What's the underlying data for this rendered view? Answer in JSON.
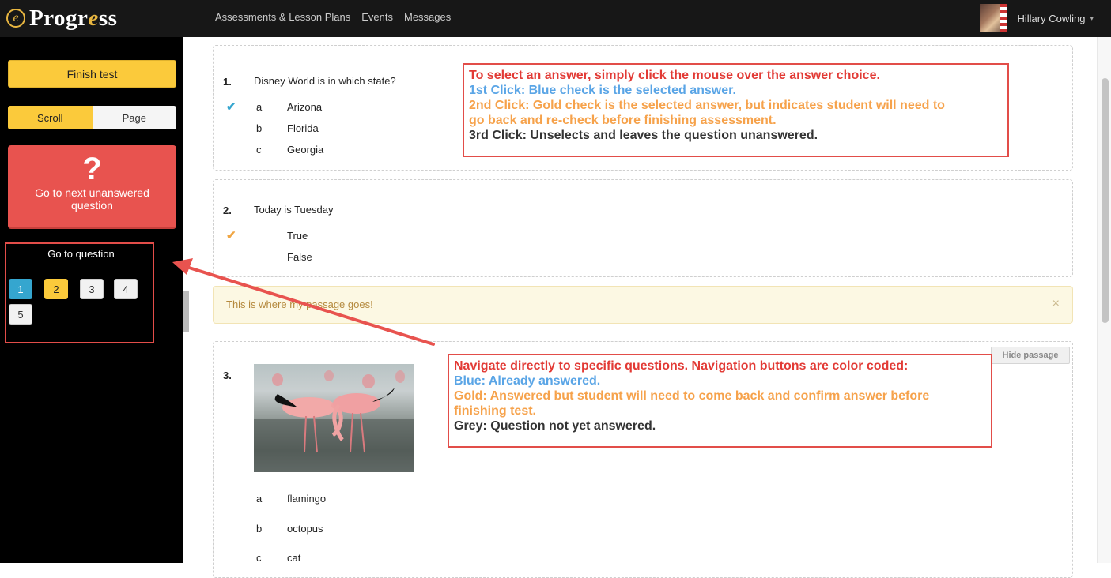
{
  "brand": {
    "logo_icon": "e",
    "name_pre": "Progr",
    "name_hl": "e",
    "name_post": "ss"
  },
  "nav": {
    "items": [
      "Assessments & Lesson Plans",
      "Events",
      "Messages"
    ]
  },
  "user": {
    "name": "Hillary Cowling"
  },
  "sidebar": {
    "finish_label": "Finish test",
    "mode_scroll": "Scroll",
    "mode_page": "Page",
    "next_symbol": "?",
    "next_label": "Go to next unanswered question",
    "goto_title": "Go to question",
    "question_buttons": [
      {
        "label": "1",
        "status": "answered",
        "color": "#35a6cf"
      },
      {
        "label": "2",
        "status": "recheck",
        "color": "#fbca3b"
      },
      {
        "label": "3",
        "status": "unanswered",
        "color": "#f2f2f2"
      },
      {
        "label": "4",
        "status": "unanswered",
        "color": "#f2f2f2"
      },
      {
        "label": "5",
        "status": "unanswered",
        "color": "#f2f2f2"
      }
    ]
  },
  "questions": [
    {
      "number": "1.",
      "text": "Disney World is in which state?",
      "options": [
        {
          "letter": "a",
          "text": "Arizona",
          "check": "blue"
        },
        {
          "letter": "b",
          "text": "Florida"
        },
        {
          "letter": "c",
          "text": "Georgia"
        }
      ]
    },
    {
      "number": "2.",
      "text": "Today is Tuesday",
      "options": [
        {
          "letter": "",
          "text": "True",
          "check": "gold"
        },
        {
          "letter": "",
          "text": "False"
        }
      ]
    },
    {
      "number": "3.",
      "image": "flamingo-photo",
      "options": [
        {
          "letter": "a",
          "text": "flamingo"
        },
        {
          "letter": "b",
          "text": "octopus"
        },
        {
          "letter": "c",
          "text": "cat"
        }
      ]
    }
  ],
  "passage": {
    "text": "This is where my passage goes!",
    "close": "×",
    "hide_label": "Hide passage"
  },
  "annotations": {
    "select": {
      "line1": "To select an answer, simply click the mouse over the answer choice.",
      "line2": "1st Click: Blue check is the selected answer.",
      "line3": "2nd Click: Gold check is the selected answer, but indicates student will need to",
      "line4": "go back and re-check before finishing assessment.",
      "line5": "3rd Click: Unselects and leaves the question unanswered."
    },
    "navigate": {
      "line1": "Navigate directly to specific questions. Navigation buttons are color coded:",
      "line2": "Blue: Already answered.",
      "line3": "Gold: Answered but student will need to come back and confirm answer before",
      "line4": "finishing test.",
      "line5": "Grey: Question not yet answered."
    }
  },
  "colors": {
    "accent_gold": "#fbca3b",
    "answered_blue": "#35a6cf",
    "danger_red": "#e8534f",
    "annotation_red": "#e24d49"
  }
}
